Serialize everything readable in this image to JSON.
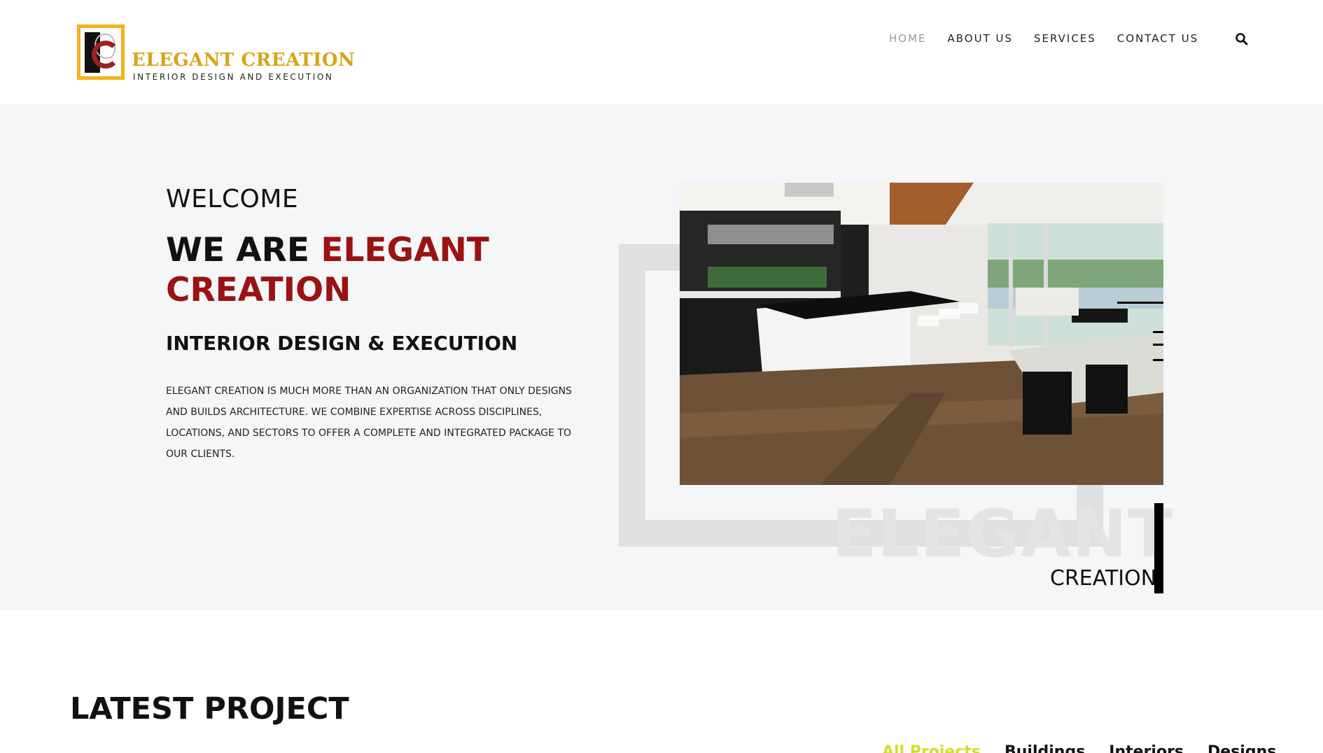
{
  "brand": {
    "name": "ELEGANT CREATION",
    "tagline": "INTERIOR DESIGN AND EXECUTION",
    "gold": "#d7a418",
    "maroon": "#9a1212"
  },
  "nav": {
    "items": [
      {
        "label": "HOME",
        "active": true
      },
      {
        "label": "ABOUT US",
        "active": false
      },
      {
        "label": "SERVICES",
        "active": false
      },
      {
        "label": "CONTACT US",
        "active": false
      }
    ],
    "search_icon": "search-icon"
  },
  "hero": {
    "welcome": "WELCOME",
    "headline_lead": "WE ARE ",
    "headline_accent": "ELEGANT CREATION",
    "subhead": "INTERIOR DESIGN & EXECUTION",
    "body": "ELEGANT CREATION IS MUCH MORE THAN AN ORGANIZATION THAT ONLY DESIGNS AND BUILDS ARCHITECTURE. WE COMBINE EXPERTISE ACROSS DISCIPLINES, LOCATIONS, AND SECTORS TO OFFER A COMPLETE AND INTEGRATED PACKAGE TO OUR CLIENTS.",
    "watermark": "ELEGANT",
    "caption": "CREATION"
  },
  "projects": {
    "title": "LATEST PROJECT",
    "filters": [
      {
        "label": "All Projects",
        "active": true
      },
      {
        "label": "Buildings",
        "active": false
      },
      {
        "label": "Interiors",
        "active": false
      },
      {
        "label": "Designs",
        "active": false
      }
    ]
  }
}
